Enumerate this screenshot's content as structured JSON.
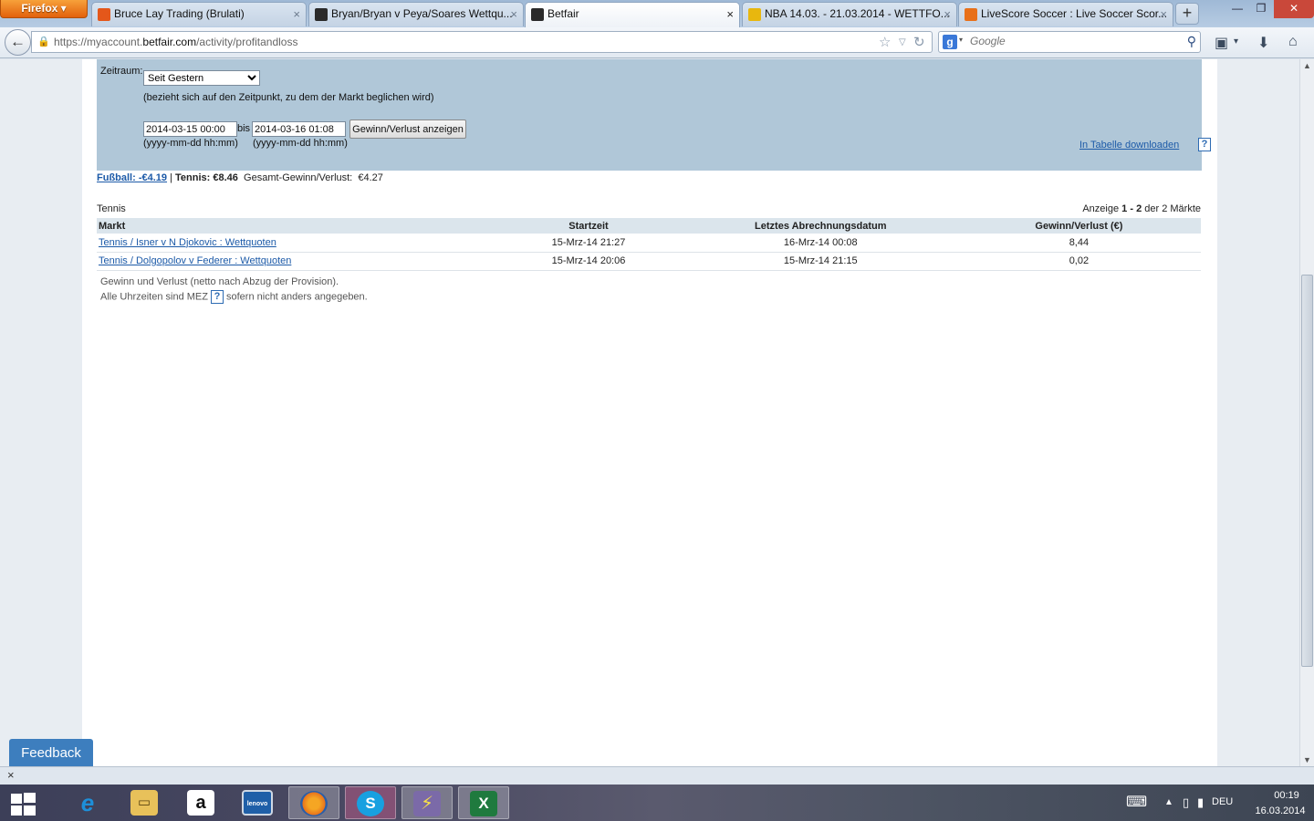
{
  "browser": {
    "menu_button": "Firefox",
    "tabs": [
      {
        "label": "Bruce Lay Trading (Brulati)",
        "favicon_color": "#e4571a"
      },
      {
        "label": "Bryan/Bryan v Peya/Soares Wettqu...",
        "favicon_color": "#2a2a2a"
      },
      {
        "label": "Betfair",
        "favicon_color": "#2a2a2a"
      },
      {
        "label": "NBA 14.03. - 21.03.2014 - WETTFO...",
        "favicon_color": "#e8b70e"
      },
      {
        "label": "LiveScore Soccer : Live Soccer Scor...",
        "favicon_color": "#e8701a"
      }
    ],
    "new_tab": "+",
    "window_controls": {
      "minimize": "—",
      "maximize": "❐",
      "close": "✕"
    },
    "url_prefix": "https://myaccount.",
    "url_domain": "betfair.com",
    "url_path": "/activity/profitandloss",
    "search_placeholder": "Google",
    "search_engine_letter": "g"
  },
  "filter": {
    "zeitraum_label": "Zeitraum:",
    "zeitraum_selected": "Seit Gestern",
    "zeitraum_note": "(bezieht sich auf den Zeitpunkt, zu dem der Markt beglichen wird)",
    "from_value": "2014-03-15 00:00",
    "to_label": "bis",
    "to_value": "2014-03-16 01:08",
    "format_hint_from": "(yyyy-mm-dd hh:mm)",
    "format_hint_to": "(yyyy-mm-dd hh:mm)",
    "show_button": "Gewinn/Verlust anzeigen",
    "download_link": "In Tabelle downloaden",
    "help_glyph": "?"
  },
  "summary": {
    "football_link": "Fußball: -€4.19",
    "separator": "|",
    "tennis": "Tennis: €8.46",
    "total_label": "Gesamt-Gewinn/Verlust:",
    "total_value": "€4.27"
  },
  "results": {
    "section_title": "Tennis",
    "count_prefix": "Anzeige",
    "count_from": "1",
    "count_dash": "-",
    "count_to": "2",
    "count_suffix": "der 2 Märkte",
    "columns": [
      "Markt",
      "Startzeit",
      "Letztes Abrechnungsdatum",
      "Gewinn/Verlust (€)"
    ],
    "rows": [
      {
        "market": "Tennis / Isner v N Djokovic : Wettquoten",
        "start": "15-Mrz-14 21:27",
        "settled": "16-Mrz-14 00:08",
        "pl": "8,44"
      },
      {
        "market": "Tennis / Dolgopolov v Federer : Wettquoten",
        "start": "15-Mrz-14 20:06",
        "settled": "15-Mrz-14 21:15",
        "pl": "0,02"
      }
    ],
    "footnote1": "Gewinn und Verlust (netto nach Abzug der Provision).",
    "footnote2_before": "Alle Uhrzeiten sind MEZ",
    "footnote2_after": "sofern nicht anders angegeben."
  },
  "feedback_button": "Feedback",
  "taskbar": {
    "apps": [
      {
        "name": "internet-explorer",
        "glyph": "e",
        "color": "#1d8fd9"
      },
      {
        "name": "file-explorer",
        "glyph": "▭",
        "color": "#e8c15a"
      },
      {
        "name": "amazon",
        "glyph": "a",
        "color": "#ffffff"
      },
      {
        "name": "lenovo",
        "glyph": "lenovo",
        "color": "#1f5fa8"
      },
      {
        "name": "firefox",
        "glyph": "◉",
        "color": "#e8731c"
      },
      {
        "name": "skype",
        "glyph": "S",
        "color": "#18a0e0"
      },
      {
        "name": "power-tool",
        "glyph": "⚡",
        "color": "#7b6aa8"
      },
      {
        "name": "excel",
        "glyph": "X",
        "color": "#1f7a3e"
      }
    ],
    "language": "DEU",
    "time": "00:19",
    "date": "16.03.2014"
  }
}
